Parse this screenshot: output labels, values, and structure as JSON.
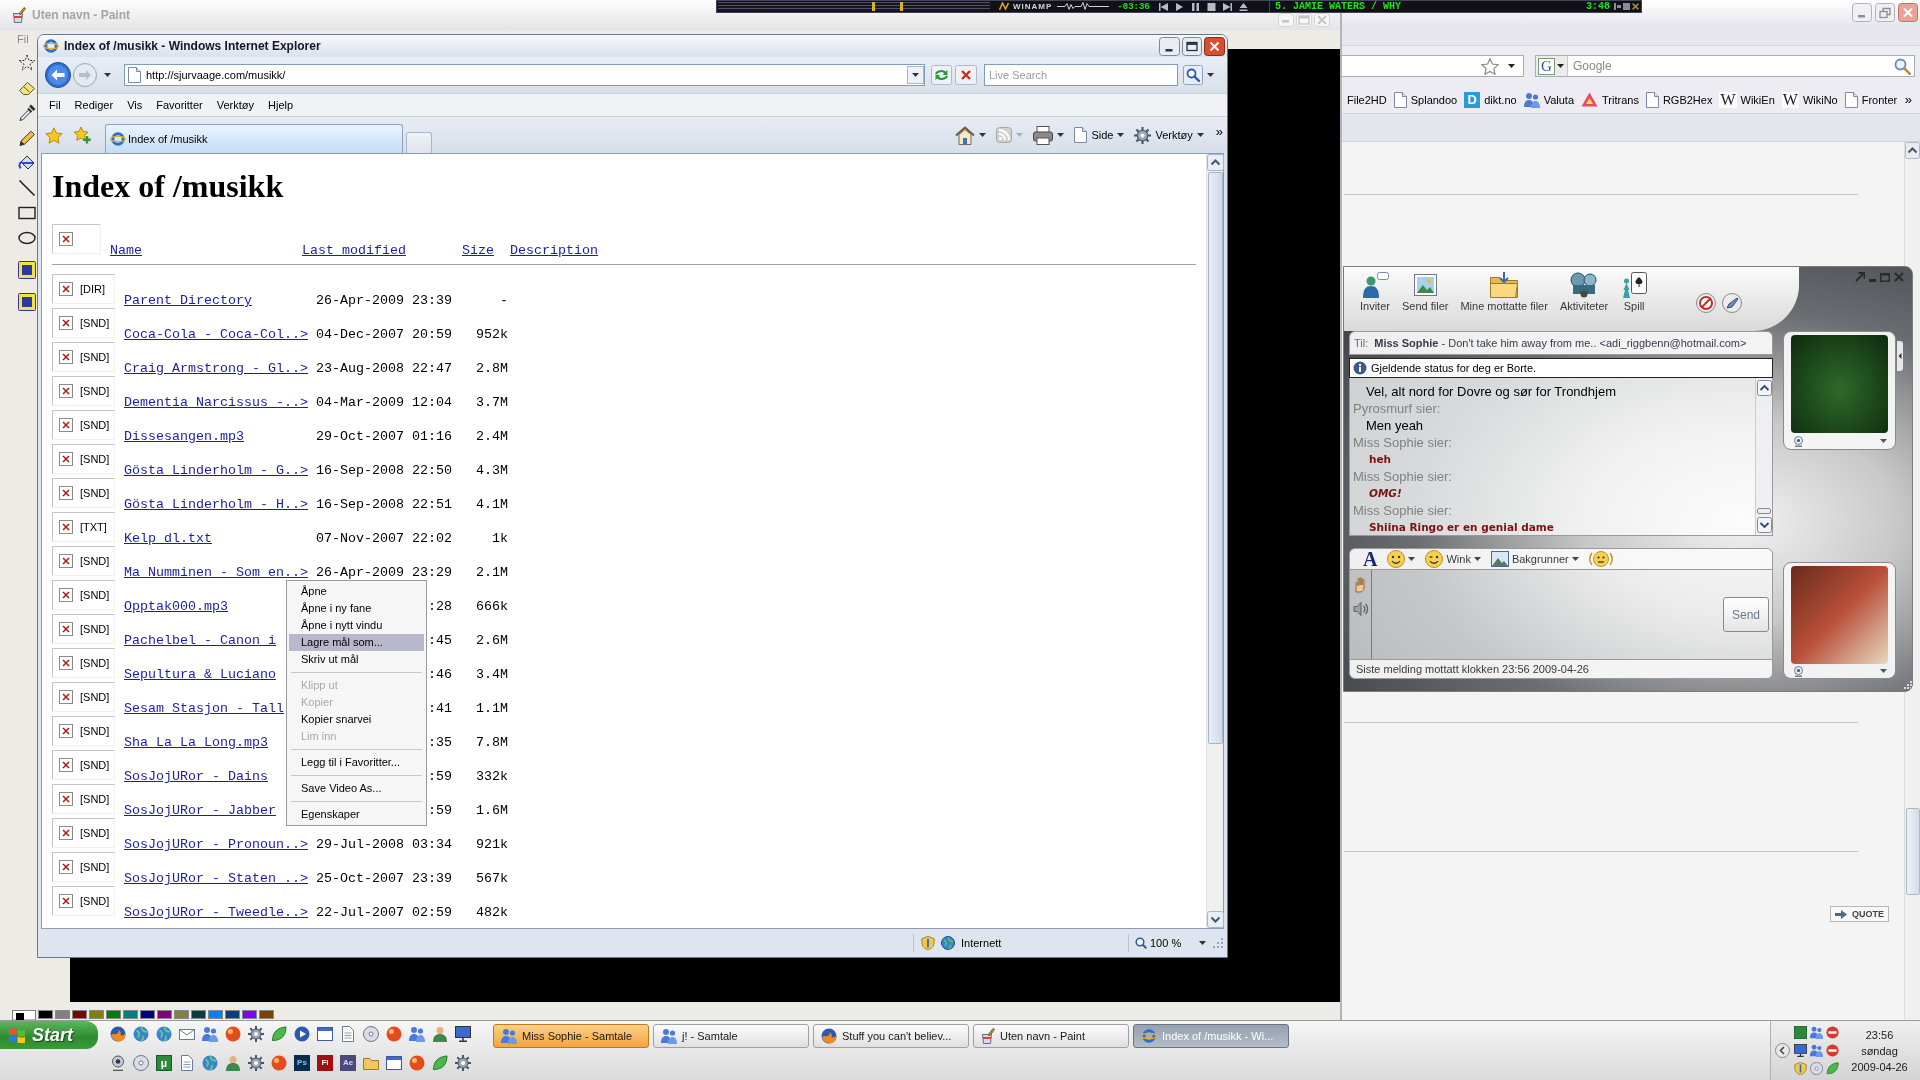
{
  "paint_window": {
    "title": "Uten navn - Paint",
    "menu": [
      "Fil"
    ],
    "palette": [
      {
        "color": "#000000"
      },
      {
        "color": "#808080"
      },
      {
        "color": "#800000"
      },
      {
        "color": "#808000"
      },
      {
        "color": "#008000"
      },
      {
        "color": "#008080"
      },
      {
        "color": "#000080"
      },
      {
        "color": "#800080"
      },
      {
        "color": "#808040"
      },
      {
        "color": "#004040"
      },
      {
        "color": "#0080ff"
      },
      {
        "color": "#004080"
      },
      {
        "color": "#8000ff"
      },
      {
        "color": "#804000"
      }
    ]
  },
  "winamp": {
    "logo": "WINAMP",
    "time": "-03:36",
    "track": "5. JAMIE WATERS / WHY",
    "track_time": "3:48"
  },
  "ie_window": {
    "title": "Index of /musikk - Windows Internet Explorer",
    "address": "http://sjurvaage.com/musikk/",
    "search_placeholder": "Live Search",
    "menu": [
      "Fil",
      "Rediger",
      "Vis",
      "Favoritter",
      "Verktøy",
      "Hjelp"
    ],
    "tabs": [
      {
        "label": "Index of /musikk",
        "selected": true
      }
    ],
    "commands": [
      "Side",
      "Verktøy"
    ],
    "overflow": "»",
    "page": {
      "heading": "Index of /musikk",
      "columns": [
        "Name",
        "Last modified",
        "Size",
        "Description"
      ],
      "rows": [
        {
          "type": "[DIR]",
          "name": "Parent Directory",
          "modified": "26-Apr-2009 23:39",
          "size": "-"
        },
        {
          "type": "[SND]",
          "name": "Coca-Cola - Coca-Col..>",
          "modified": "04-Dec-2007 20:59",
          "size": "952k"
        },
        {
          "type": "[SND]",
          "name": "Craig Armstrong - Gl..>",
          "modified": "23-Aug-2008 22:47",
          "size": "2.8M"
        },
        {
          "type": "[SND]",
          "name": "Dementia Narcissus -..>",
          "modified": "04-Mar-2009 12:04",
          "size": "3.7M"
        },
        {
          "type": "[SND]",
          "name": "Dissesangen.mp3",
          "modified": "29-Oct-2007 01:16",
          "size": "2.4M"
        },
        {
          "type": "[SND]",
          "name": "Gösta Linderholm - G..>",
          "modified": "16-Sep-2008 22:50",
          "size": "4.3M"
        },
        {
          "type": "[SND]",
          "name": "Gösta Linderholm - H..>",
          "modified": "16-Sep-2008 22:51",
          "size": "4.1M"
        },
        {
          "type": "[TXT]",
          "name": "Kelp_dl.txt",
          "modified": "07-Nov-2007 22:02",
          "size": "1k"
        },
        {
          "type": "[SND]",
          "name": "Ma Numminen - Som en..>",
          "modified": "26-Apr-2009 23:29",
          "size": "2.1M"
        },
        {
          "type": "[SND]",
          "name": "Opptak000.mp3",
          "modified": ":28",
          "size": "666k"
        },
        {
          "type": "[SND]",
          "name": "Pachelbel - Canon i",
          "modified": ":45",
          "size": "2.6M"
        },
        {
          "type": "[SND]",
          "name": "Sepultura & Luciano",
          "modified": ":46",
          "size": "3.4M"
        },
        {
          "type": "[SND]",
          "name": "Sesam Stasjon - Tall",
          "modified": ":41",
          "size": "1.1M"
        },
        {
          "type": "[SND]",
          "name": "Sha La La Long.mp3",
          "modified": ":35",
          "size": "7.8M"
        },
        {
          "type": "[SND]",
          "name": "SosJojURor - Dains",
          "modified": ":59",
          "size": "332k"
        },
        {
          "type": "[SND]",
          "name": "SosJojURor - Jabber",
          "modified": ":59",
          "size": "1.6M"
        },
        {
          "type": "[SND]",
          "name": "SosJojURor - Pronoun..>",
          "modified": "29-Jul-2008 03:34",
          "size": "921k"
        },
        {
          "type": "[SND]",
          "name": "SosJojURor - Staten ..>",
          "modified": "25-Oct-2007 23:39",
          "size": "567k"
        },
        {
          "type": "[SND]",
          "name": "SosJojURor - Tweedle..>",
          "modified": "22-Jul-2007 02:59",
          "size": "482k"
        }
      ]
    },
    "context_menu": [
      [
        {
          "label": "Åpne",
          "selected": false,
          "disabled": false
        },
        {
          "label": "Åpne i ny fane",
          "selected": false,
          "disabled": false
        },
        {
          "label": "Åpne i nytt vindu",
          "selected": false,
          "disabled": false
        },
        {
          "label": "Lagre mål som...",
          "selected": true,
          "disabled": false
        },
        {
          "label": "Skriv ut mål",
          "selected": false,
          "disabled": false
        }
      ],
      [
        {
          "label": "Klipp ut",
          "selected": false,
          "disabled": true
        },
        {
          "label": "Kopier",
          "selected": false,
          "disabled": true
        },
        {
          "label": "Kopier snarvei",
          "selected": false,
          "disabled": false
        },
        {
          "label": "Lim inn",
          "selected": false,
          "disabled": true
        }
      ],
      [
        {
          "label": "Legg til i Favoritter...",
          "selected": false,
          "disabled": false
        }
      ],
      [
        {
          "label": "Save Video As...",
          "selected": false,
          "disabled": false
        }
      ],
      [
        {
          "label": "Egenskaper",
          "selected": false,
          "disabled": false
        }
      ]
    ],
    "status_bar": {
      "zone": "Internett",
      "zoom": "100 %"
    }
  },
  "firefox_window": {
    "search_engine": "G",
    "search_placeholder": "Google",
    "bookmarks": [
      {
        "kind": "text",
        "label": "File2HD"
      },
      {
        "kind": "page",
        "label": "Splandoo"
      },
      {
        "kind": "tile",
        "icon_text": "D",
        "label": "dikt.no"
      },
      {
        "kind": "people",
        "label": "Valuta"
      },
      {
        "kind": "triangle",
        "label": "Tritrans"
      },
      {
        "kind": "page",
        "label": "RGB2Hex"
      },
      {
        "kind": "letter",
        "icon_text": "W",
        "label": "WikiEn"
      },
      {
        "kind": "letter",
        "icon_text": "W",
        "label": "WikiNo"
      },
      {
        "kind": "page",
        "label": "Fronter"
      }
    ],
    "bookmarks_overflow": "»",
    "quote_button": "QUOTE"
  },
  "messenger_window": {
    "toolbar": [
      "Inviter",
      "Send filer",
      "Mine mottatte filer",
      "Aktiviteter",
      "Spill"
    ],
    "to_label": "Til:",
    "recipient": "**Miss Sophie** - Don't take him away from me.. <adi_riggbenn@hotmail.com>",
    "status_notice": "Gjeldende status for deg er Borte.",
    "history": [
      {
        "kind": "message",
        "text": "Vel, alt nord for Dovre og sør for Trondhjem",
        "italic": false
      },
      {
        "kind": "sender",
        "text": "Pyrosmurf sier:",
        "italic": false
      },
      {
        "kind": "message",
        "text": "Men yeah",
        "italic": false
      },
      {
        "kind": "sender",
        "text": "Miss Sophie sier:",
        "italic": false
      },
      {
        "kind": "styled",
        "text": "heh",
        "italic": false
      },
      {
        "kind": "sender",
        "text": "Miss Sophie sier:",
        "italic": false
      },
      {
        "kind": "styled",
        "text": "OMG!",
        "italic": true
      },
      {
        "kind": "sender",
        "text": "Miss Sophie sier:",
        "italic": false
      },
      {
        "kind": "styled",
        "text": "Shiina Ringo er en genial dame",
        "italic": false
      }
    ],
    "font_button": "A",
    "input_toolbar": [
      "Wink",
      "Bakgrunner"
    ],
    "send_button": "Send",
    "status_bar": "Siste melding mottatt klokken 23:56 2009-04-26"
  },
  "taskbar": {
    "start": "Start",
    "quick_launch_labels": [
      "µ",
      "Ps",
      "Fl",
      "Ae"
    ],
    "tasks": [
      {
        "label": "Miss Sophie - Samtale",
        "selected": false,
        "flashing": true
      },
      {
        "label": "j! - Samtale",
        "selected": false,
        "flashing": false
      },
      {
        "label": "Stuff you can't believ...",
        "selected": false,
        "flashing": false
      },
      {
        "label": "Uten navn - Paint",
        "selected": false,
        "flashing": false
      },
      {
        "label": "Index of /musikk - Wi...",
        "selected": true,
        "flashing": false
      }
    ],
    "clock": {
      "time": "23:56",
      "day": "søndag",
      "date": "2009-04-26"
    }
  }
}
